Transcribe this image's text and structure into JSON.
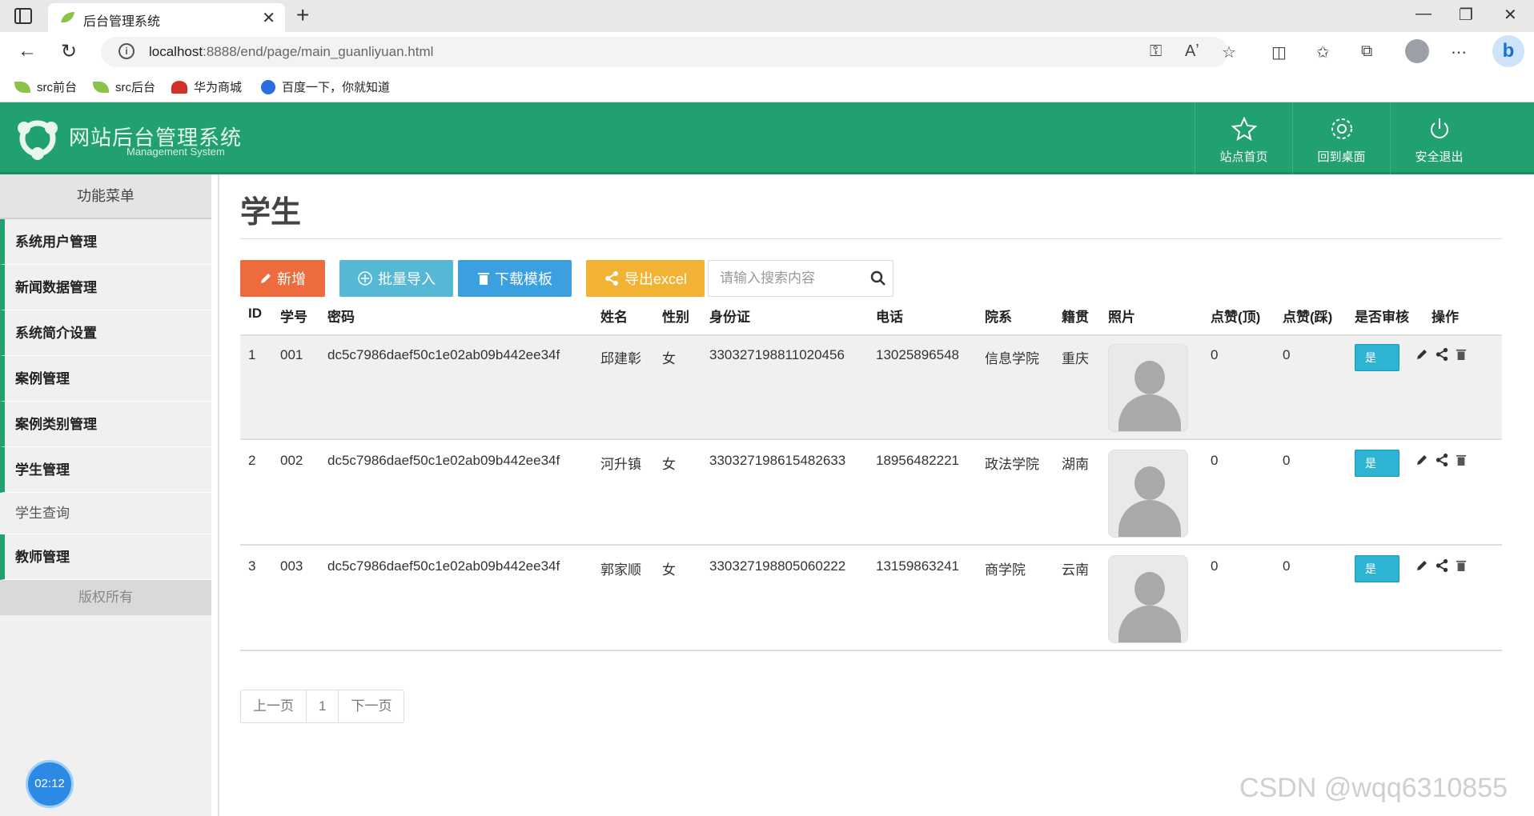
{
  "browser": {
    "tab_title": "后台管理系统",
    "url_host": "localhost",
    "url_path": ":8888/end/page/main_guanliyuan.html",
    "bookmarks": [
      {
        "label": "src前台",
        "icon": "leaf-icon"
      },
      {
        "label": "src后台",
        "icon": "leaf-icon"
      },
      {
        "label": "华为商城",
        "icon": "huawei-icon"
      },
      {
        "label": "百度一下，你就知道",
        "icon": "baidu-paw-icon"
      }
    ]
  },
  "header": {
    "title": "网站后台管理系统",
    "subtitle": "Management System",
    "brand_color": "#22a170",
    "buttons": [
      {
        "label": "站点首页",
        "icon": "star-icon"
      },
      {
        "label": "回到桌面",
        "icon": "gear-icon"
      },
      {
        "label": "安全退出",
        "icon": "power-icon"
      }
    ]
  },
  "sidebar": {
    "heading": "功能菜单",
    "items": [
      {
        "label": "系统用户管理"
      },
      {
        "label": "新闻数据管理"
      },
      {
        "label": "系统简介设置"
      },
      {
        "label": "案例管理"
      },
      {
        "label": "案例类别管理"
      },
      {
        "label": "学生管理"
      },
      {
        "label": "学生查询"
      },
      {
        "label": "教师管理"
      }
    ],
    "footer": "版权所有",
    "timer": "02:12"
  },
  "main": {
    "title": "学生",
    "toolbar": {
      "add": "新增",
      "import": "批量导入",
      "template": "下载模板",
      "export": "导出excel",
      "search_placeholder": "请输入搜索内容"
    },
    "columns": [
      "ID",
      "学号",
      "密码",
      "姓名",
      "性别",
      "身份证",
      "电话",
      "院系",
      "籍贯",
      "照片",
      "点赞(顶)",
      "点赞(踩)",
      "是否审核",
      "操作"
    ],
    "rows": [
      {
        "id": "1",
        "sno": "001",
        "pwd": "dc5c7986daef50c1e02ab09b442ee34f",
        "name": "邱建彰",
        "sex": "女",
        "idcard": "330327198811020456",
        "phone": "13025896548",
        "dept": "信息学院",
        "origin": "重庆",
        "up": "0",
        "down": "0",
        "audit": "是"
      },
      {
        "id": "2",
        "sno": "002",
        "pwd": "dc5c7986daef50c1e02ab09b442ee34f",
        "name": "河升镇",
        "sex": "女",
        "idcard": "330327198615482633",
        "phone": "18956482221",
        "dept": "政法学院",
        "origin": "湖南",
        "up": "0",
        "down": "0",
        "audit": "是"
      },
      {
        "id": "3",
        "sno": "003",
        "pwd": "dc5c7986daef50c1e02ab09b442ee34f",
        "name": "郭家顺",
        "sex": "女",
        "idcard": "330327198805060222",
        "phone": "13159863241",
        "dept": "商学院",
        "origin": "云南",
        "up": "0",
        "down": "0",
        "audit": "是"
      }
    ],
    "pager": {
      "prev": "上一页",
      "page": "1",
      "next": "下一页"
    }
  },
  "watermark": "CSDN @wqq6310855"
}
